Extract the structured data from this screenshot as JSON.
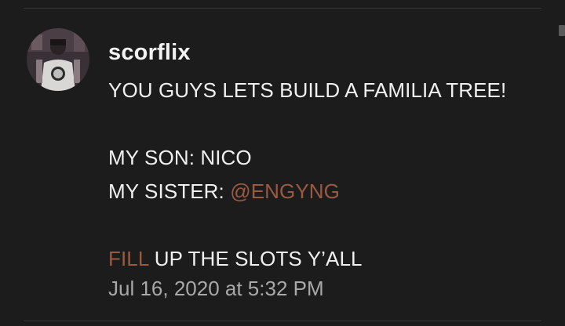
{
  "post": {
    "username": "scorflix",
    "line1": "YOU GUYS LETS BUILD A FAMILIA TREE!",
    "line2": "MY SON: NICO",
    "line3_prefix": "MY SISTER: ",
    "mention": "@ENGYNG",
    "fill_word": "FILL",
    "line4_rest": " UP THE SLOTS Y’ALL",
    "timestamp": "Jul 16, 2020 at 5:32 PM"
  },
  "colors": {
    "background": "#1c1c1c",
    "text": "#f0f0f0",
    "link": "#9b5a3f",
    "timestamp": "#a9a9a9"
  },
  "icons": {
    "avatar": "user-avatar"
  }
}
